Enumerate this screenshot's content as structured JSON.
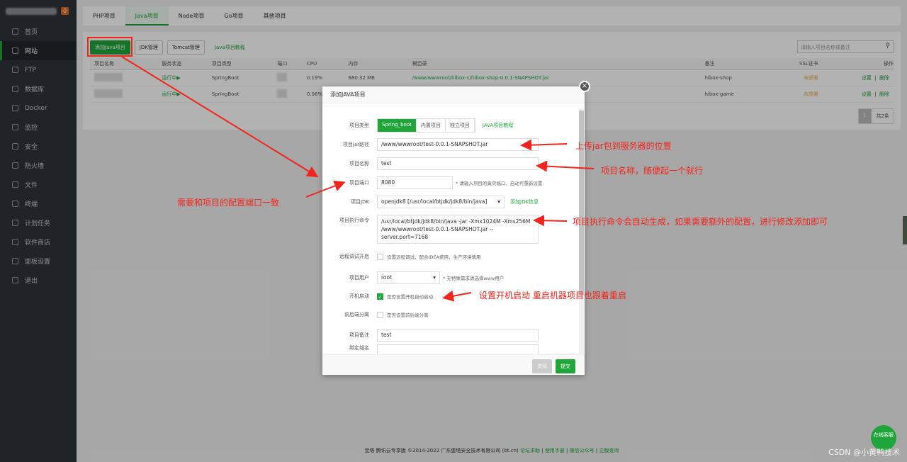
{
  "sidebar": {
    "badge": "0",
    "items": [
      "首页",
      "网站",
      "FTP",
      "数据库",
      "Docker",
      "监控",
      "安全",
      "防火墙",
      "文件",
      "终端",
      "计划任务",
      "软件商店",
      "面板设置",
      "退出"
    ]
  },
  "tabs": [
    "PHP项目",
    "Java项目",
    "Node项目",
    "Go项目",
    "其他项目"
  ],
  "toolbar": {
    "add": "添加Java项目",
    "jdk": "JDK管理",
    "tomcat": "Tomcat管理",
    "tutorial": "Java项目教程",
    "search_placeholder": "请输入项目名称或备注"
  },
  "table": {
    "headers": [
      "项目名称",
      "服务状态",
      "项目类型",
      "端口",
      "CPU",
      "内存",
      "根目录",
      "备注",
      "SSL证书",
      "操作"
    ],
    "rows": [
      {
        "status": "运行中▶",
        "type": "SpringBoot",
        "cpu": "0.19%",
        "mem": "680.32 MB",
        "root": "/www/wwwroot/hibox-c/hibox-shop-0.0.1-SNAPSHOT.jar",
        "note": "hibox-shop",
        "ssl": "未部署",
        "set": "设置",
        "del": "删除"
      },
      {
        "status": "运行中▶",
        "type": "SpringBoot",
        "cpu": "0.06%",
        "mem": "",
        "root": "",
        "note": "hibox-game",
        "ssl": "未部署",
        "set": "设置",
        "del": "删除"
      }
    ],
    "page": "1",
    "total": "共2条"
  },
  "modal": {
    "title": "添加JAVA项目",
    "type_label": "项目类型",
    "types": [
      "Spring_boot",
      "内置项目",
      "独立项目"
    ],
    "type_tutorial": "JAVA项目教程",
    "jar_label": "项目jar路径",
    "jar": "/www/wwwroot/test-0.0.1-SNAPSHOT.jar",
    "name_label": "项目名称",
    "name": "test",
    "port_label": "项目端口",
    "port": "8080",
    "port_hint": "* 请输入项目的真实端口，启动可重新设置",
    "jdk_label": "项目JDK",
    "jdk": "openjdk8 [/usr/local/btjdk/jdk8/bin/java]",
    "jdk_add": "添加JDK信息",
    "cmd_label": "项目执行命令",
    "cmd_line1": "/usr/local/btjdk/jdk8/bin/java -jar -Xmx1024M -Xms256M",
    "cmd_line2": "/www/wwwroot/test-0.0.1-SNAPSHOT.jar --server.port=7168",
    "debug_label": "远程调试开启",
    "debug_hint": "设置远程调试，配合IDEA使用，生产环境慎用",
    "user_label": "项目用户",
    "user": "root",
    "user_hint": "* 无特殊需求请选择www用户",
    "boot_label": "开机启动",
    "boot_hint": "是否设置开机自动启动",
    "sep_label": "前后端分离",
    "sep_hint": "是否设置前后端分离",
    "remark_label": "项目备注",
    "remark": "test",
    "domain_label": "绑定域名",
    "cancel": "关闭",
    "submit": "提交"
  },
  "annotations": {
    "jar": "上传jar包到服务器的位置",
    "name": "项目名称，随便起一个就行",
    "port": "需要和项目的配置端口一致",
    "cmd": "项目执行命令会自动生成，如果需要额外的配置，进行修改添加即可",
    "boot": "设置开机启动 重启机器项目也跟着重启"
  },
  "footer": {
    "copyright": "宝塔 腾讯云专享版 ©2014-2022 广东堡塔安全技术有限公司 (bt.cn)",
    "links": [
      "论坛求助",
      "使用手册",
      "微信公众号",
      "正版查询"
    ]
  },
  "kefu": "在线客服",
  "watermark": "CSDN @小黄鸭技术",
  "colors": {
    "accent": "#20a53a",
    "annotation": "#f2241c"
  }
}
